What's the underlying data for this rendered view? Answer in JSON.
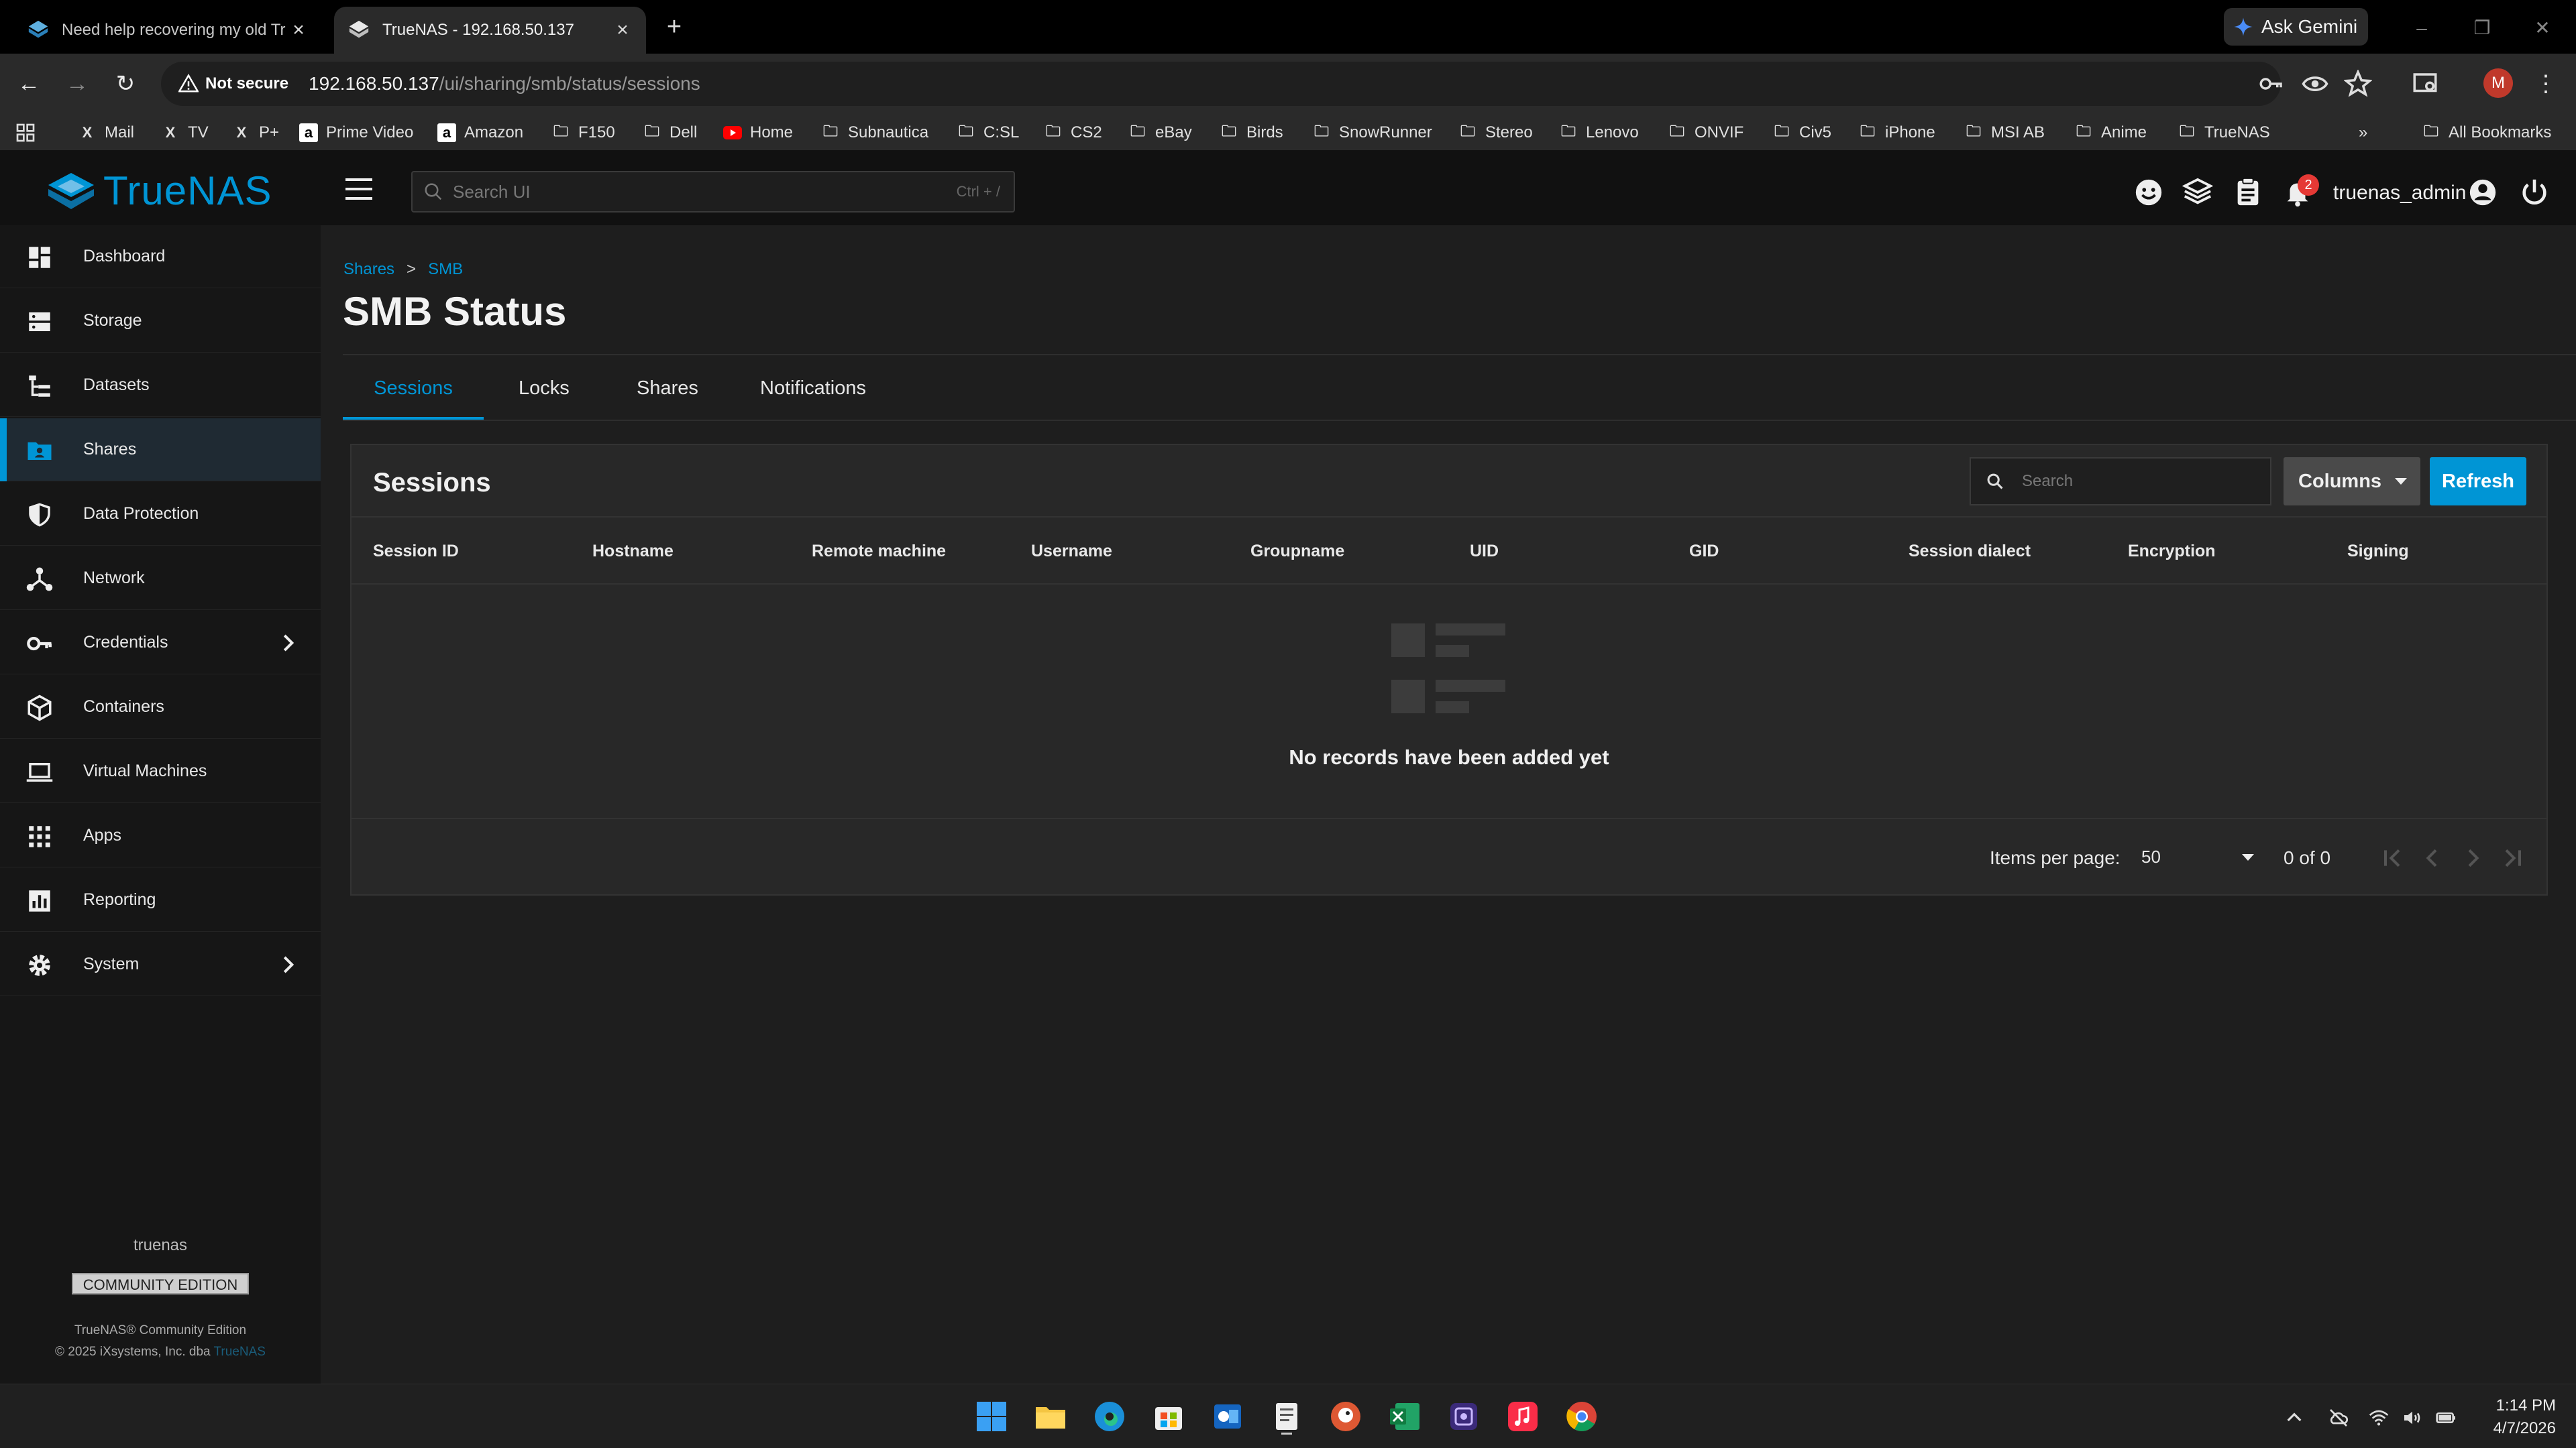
{
  "browser": {
    "tabs": [
      {
        "title": "Need help recovering my old Tr"
      },
      {
        "title": "TrueNAS - 192.168.50.137"
      }
    ],
    "gemini_label": "Ask Gemini",
    "not_secure_label": "Not secure",
    "url_host": "192.168.50.137",
    "url_path": "/ui/sharing/smb/status/sessions",
    "profile_initial": "M",
    "bookmarks": [
      "Mail",
      "TV",
      "P+",
      "Prime Video",
      "Amazon",
      "F150",
      "Dell",
      "Home",
      "Subnautica",
      "C:SL",
      "CS2",
      "eBay",
      "Birds",
      "SnowRunner",
      "Stereo",
      "Lenovo",
      "ONVIF",
      "Civ5",
      "iPhone",
      "MSI AB",
      "Anime",
      "TrueNAS"
    ],
    "all_bookmarks_label": "All Bookmarks"
  },
  "topbar": {
    "logo_text": "TrueNAS",
    "search_placeholder": "Search UI",
    "search_shortcut": "Ctrl + /",
    "notification_count": "2",
    "username": "truenas_admin"
  },
  "sidebar": {
    "items": [
      {
        "label": "Dashboard",
        "icon": "dashboard-icon"
      },
      {
        "label": "Storage",
        "icon": "storage-icon"
      },
      {
        "label": "Datasets",
        "icon": "datasets-icon"
      },
      {
        "label": "Shares",
        "icon": "shares-icon",
        "active": true
      },
      {
        "label": "Data Protection",
        "icon": "shield-icon"
      },
      {
        "label": "Network",
        "icon": "network-icon"
      },
      {
        "label": "Credentials",
        "icon": "key-icon",
        "expandable": true
      },
      {
        "label": "Containers",
        "icon": "containers-icon"
      },
      {
        "label": "Virtual Machines",
        "icon": "laptop-icon"
      },
      {
        "label": "Apps",
        "icon": "apps-grid-icon"
      },
      {
        "label": "Reporting",
        "icon": "reporting-icon"
      },
      {
        "label": "System",
        "icon": "gear-icon",
        "expandable": true
      }
    ],
    "hostname": "truenas",
    "edition": "COMMUNITY EDITION",
    "copyright_line1": "TrueNAS® Community Edition",
    "copyright_line2": "© 2025 iXsystems, Inc. dba",
    "copyright_link": "TrueNAS"
  },
  "main": {
    "breadcrumb": [
      "Shares",
      "SMB"
    ],
    "breadcrumb_sep": ">",
    "title": "SMB Status",
    "tabs": [
      "Sessions",
      "Locks",
      "Shares",
      "Notifications"
    ],
    "active_tab": "Sessions",
    "card": {
      "title": "Sessions",
      "search_placeholder": "Search",
      "columns_label": "Columns",
      "refresh_label": "Refresh",
      "headers": [
        "Session ID",
        "Hostname",
        "Remote machine",
        "Username",
        "Groupname",
        "UID",
        "GID",
        "Session dialect",
        "Encryption",
        "Signing"
      ],
      "empty_text": "No records have been added yet",
      "items_per_page_label": "Items per page:",
      "items_per_page": "50",
      "range": "0 of 0"
    }
  },
  "taskbar": {
    "time": "1:14 PM",
    "date": "4/7/2026"
  },
  "colors": {
    "accent": "#0095d5",
    "background": "#1e1e1e",
    "sidebar": "#161616",
    "card": "#282828"
  }
}
